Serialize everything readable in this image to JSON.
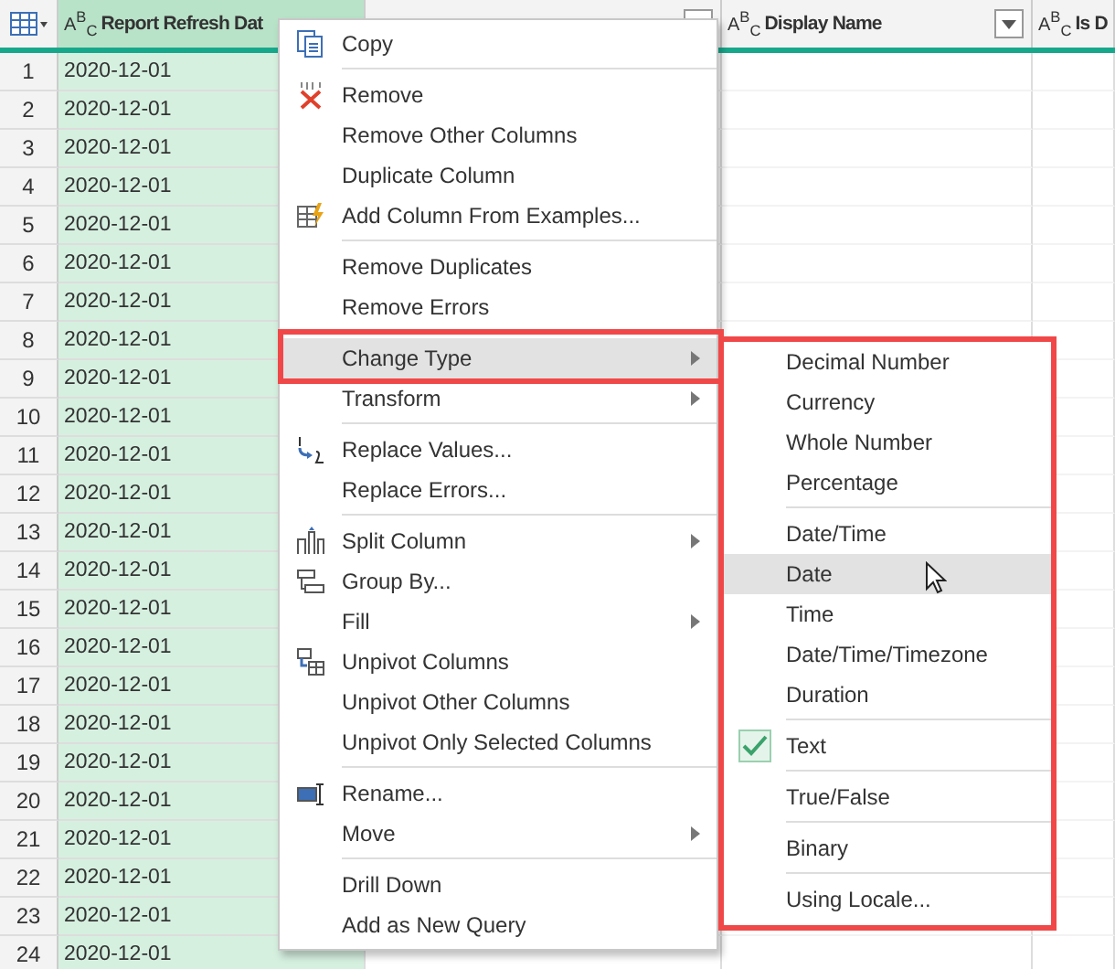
{
  "table": {
    "columns": [
      {
        "type": "A$^{B}$$_{C}$",
        "label": "Report Refresh Dat",
        "selected": true,
        "dropdown": false
      },
      {
        "selected": false,
        "dropdown": true
      },
      {
        "type": "A$^{B}$$_{C}$",
        "label": "Display Name",
        "selected": false,
        "dropdown": true
      },
      {
        "type": "A$^{B}$$_{C}$",
        "label": "Is D",
        "selected": false,
        "dropdown": false
      }
    ],
    "rows": [
      {
        "n": "1",
        "value": "2020-12-01"
      },
      {
        "n": "2",
        "value": "2020-12-01"
      },
      {
        "n": "3",
        "value": "2020-12-01"
      },
      {
        "n": "4",
        "value": "2020-12-01"
      },
      {
        "n": "5",
        "value": "2020-12-01"
      },
      {
        "n": "6",
        "value": "2020-12-01"
      },
      {
        "n": "7",
        "value": "2020-12-01"
      },
      {
        "n": "8",
        "value": "2020-12-01"
      },
      {
        "n": "9",
        "value": "2020-12-01"
      },
      {
        "n": "10",
        "value": "2020-12-01"
      },
      {
        "n": "11",
        "value": "2020-12-01"
      },
      {
        "n": "12",
        "value": "2020-12-01"
      },
      {
        "n": "13",
        "value": "2020-12-01"
      },
      {
        "n": "14",
        "value": "2020-12-01"
      },
      {
        "n": "15",
        "value": "2020-12-01"
      },
      {
        "n": "16",
        "value": "2020-12-01"
      },
      {
        "n": "17",
        "value": "2020-12-01"
      },
      {
        "n": "18",
        "value": "2020-12-01"
      },
      {
        "n": "19",
        "value": "2020-12-01"
      },
      {
        "n": "20",
        "value": "2020-12-01"
      },
      {
        "n": "21",
        "value": "2020-12-01"
      },
      {
        "n": "22",
        "value": "2020-12-01"
      },
      {
        "n": "23",
        "value": "2020-12-01"
      },
      {
        "n": "24",
        "value": "2020-12-01"
      }
    ]
  },
  "context_menu": {
    "items": [
      {
        "kind": "item",
        "label": "Copy",
        "submenu": false,
        "selected": false
      },
      {
        "kind": "separator"
      },
      {
        "kind": "item",
        "label": "Remove",
        "submenu": false,
        "selected": false
      },
      {
        "kind": "item",
        "label": "Remove Other Columns",
        "submenu": false,
        "selected": false
      },
      {
        "kind": "item",
        "label": "Duplicate Column",
        "submenu": false,
        "selected": false
      },
      {
        "kind": "item",
        "label": "Add Column From Examples...",
        "submenu": false,
        "selected": false
      },
      {
        "kind": "separator"
      },
      {
        "kind": "item",
        "label": "Remove Duplicates",
        "submenu": false,
        "selected": false
      },
      {
        "kind": "item",
        "label": "Remove Errors",
        "submenu": false,
        "selected": false
      },
      {
        "kind": "separator"
      },
      {
        "kind": "item",
        "label": "Change Type",
        "submenu": true,
        "selected": true
      },
      {
        "kind": "item",
        "label": "Transform",
        "submenu": true,
        "selected": false
      },
      {
        "kind": "separator"
      },
      {
        "kind": "item",
        "label": "Replace Values...",
        "submenu": false,
        "selected": false
      },
      {
        "kind": "item",
        "label": "Replace Errors...",
        "submenu": false,
        "selected": false
      },
      {
        "kind": "separator"
      },
      {
        "kind": "item",
        "label": "Split Column",
        "submenu": true,
        "selected": false
      },
      {
        "kind": "item",
        "label": "Group By...",
        "submenu": false,
        "selected": false
      },
      {
        "kind": "item",
        "label": "Fill",
        "submenu": true,
        "selected": false
      },
      {
        "kind": "item",
        "label": "Unpivot Columns",
        "submenu": false,
        "selected": false
      },
      {
        "kind": "item",
        "label": "Unpivot Other Columns",
        "submenu": false,
        "selected": false
      },
      {
        "kind": "item",
        "label": "Unpivot Only Selected Columns",
        "submenu": false,
        "selected": false
      },
      {
        "kind": "separator"
      },
      {
        "kind": "item",
        "label": "Rename...",
        "submenu": false,
        "selected": false
      },
      {
        "kind": "item",
        "label": "Move",
        "submenu": true,
        "selected": false
      },
      {
        "kind": "separator"
      },
      {
        "kind": "item",
        "label": "Drill Down",
        "submenu": false,
        "selected": false
      },
      {
        "kind": "item",
        "label": "Add as New Query",
        "submenu": false,
        "selected": false
      }
    ]
  },
  "submenu": {
    "items": [
      {
        "kind": "item",
        "label": "Decimal Number",
        "checked": false,
        "selected": false
      },
      {
        "kind": "item",
        "label": "Currency",
        "checked": false,
        "selected": false
      },
      {
        "kind": "item",
        "label": "Whole Number",
        "checked": false,
        "selected": false
      },
      {
        "kind": "item",
        "label": "Percentage",
        "checked": false,
        "selected": false
      },
      {
        "kind": "separator"
      },
      {
        "kind": "item",
        "label": "Date/Time",
        "checked": false,
        "selected": false
      },
      {
        "kind": "item",
        "label": "Date",
        "checked": false,
        "selected": true
      },
      {
        "kind": "item",
        "label": "Time",
        "checked": false,
        "selected": false
      },
      {
        "kind": "item",
        "label": "Date/Time/Timezone",
        "checked": false,
        "selected": false
      },
      {
        "kind": "item",
        "label": "Duration",
        "checked": false,
        "selected": false
      },
      {
        "kind": "separator"
      },
      {
        "kind": "item",
        "label": "Text",
        "checked": true,
        "selected": false
      },
      {
        "kind": "separator"
      },
      {
        "kind": "item",
        "label": "True/False",
        "checked": false,
        "selected": false
      },
      {
        "kind": "separator"
      },
      {
        "kind": "item",
        "label": "Binary",
        "checked": false,
        "selected": false
      },
      {
        "kind": "separator"
      },
      {
        "kind": "item",
        "label": "Using Locale...",
        "checked": false,
        "selected": false
      }
    ]
  }
}
